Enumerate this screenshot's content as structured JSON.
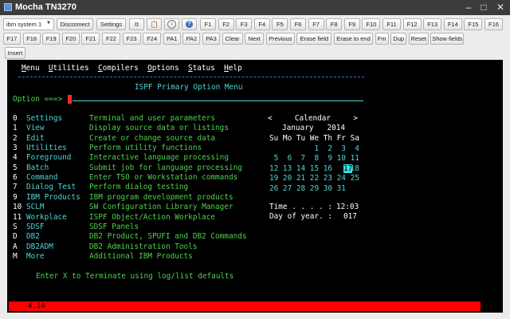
{
  "window": {
    "title": "Mocha TN3270",
    "minimize": "–",
    "maximize": "□",
    "close": "✕"
  },
  "toolbar": {
    "session_select": "ibm system 1",
    "disconnect": "Disconnect",
    "settings": "Settings",
    "icons": [
      "copy-icon",
      "paste-icon",
      "info-icon",
      "help-icon"
    ],
    "help_glyph": "?",
    "info_glyph": "i",
    "fkeys_row1": [
      "F1",
      "F2",
      "F3",
      "F4",
      "F5",
      "F6",
      "F7",
      "F8",
      "F9",
      "F10",
      "F11",
      "F12",
      "F13",
      "F14",
      "F15",
      "F16"
    ],
    "fkeys_row2": [
      "F17",
      "F18",
      "F19",
      "F20",
      "F21",
      "F22",
      "F23",
      "F24",
      "PA1",
      "PA2",
      "PA3",
      "Clear",
      "Next",
      "Previous",
      "Erase field",
      "Erase to end",
      "Fm",
      "Dup",
      "Reset",
      "Show fields"
    ],
    "insert": "Insert"
  },
  "terminal": {
    "menu": [
      "Menu",
      "Utilities",
      "Compilers",
      "Options",
      "Status",
      "Help"
    ],
    "panel_title": "ISPF Primary Option Menu",
    "option_prompt": "Option ===>",
    "options": [
      {
        "key": "0",
        "name": "Settings",
        "desc": "Terminal and user parameters"
      },
      {
        "key": "1",
        "name": "View",
        "desc": "Display source data or listings"
      },
      {
        "key": "2",
        "name": "Edit",
        "desc": "Create or change source data"
      },
      {
        "key": "3",
        "name": "Utilities",
        "desc": "Perform utility functions"
      },
      {
        "key": "4",
        "name": "Foreground",
        "desc": "Interactive language processing"
      },
      {
        "key": "5",
        "name": "Batch",
        "desc": "Submit job for language processing"
      },
      {
        "key": "6",
        "name": "Command",
        "desc": "Enter TSO or Workstation commands"
      },
      {
        "key": "7",
        "name": "Dialog Test",
        "desc": "Perform dialog testing"
      },
      {
        "key": "9",
        "name": "IBM Products",
        "desc": "IBM program development products"
      },
      {
        "key": "10",
        "name": "SCLM",
        "desc": "SW Configuration Library Manager"
      },
      {
        "key": "11",
        "name": "Workplace",
        "desc": "ISPF Object/Action Workplace"
      },
      {
        "key": "S",
        "name": "SDSF",
        "desc": "SDSF Panels"
      },
      {
        "key": "D",
        "name": "DB2",
        "desc": "DB2 Product, SPUFI and DB2 Commands"
      },
      {
        "key": "A",
        "name": "DB2ADM",
        "desc": "DB2 Administration Tools"
      },
      {
        "key": "M",
        "name": "More",
        "desc": "Additional IBM Products"
      }
    ],
    "calendar": {
      "prev": "<",
      "title": "Calendar",
      "next": ">",
      "month_year": "January   2014",
      "weekdays": "Su Mo Tu We Th Fr Sa",
      "weeks": [
        "          1  2  3  4",
        " 5  6  7  8  9 10 11",
        "12 13 14 15 16    18",
        "19 20 21 22 23 24 25",
        "26 27 28 29 30 31"
      ],
      "today": "17"
    },
    "time_label": "Time . . . . :",
    "time_value": "12:03",
    "day_label": "Day of year. :",
    "day_value": "017",
    "footer_hint": "Enter X to Terminate using log/list defaults",
    "cursor_position": "4,14"
  },
  "colors": {
    "title_bar": "#3c3c3c",
    "screen_bg": "#000000",
    "status_bar": "#ff0000",
    "green": "#4fd14f",
    "cyan": "#4fd5d5",
    "blue": "#7fa8ff"
  }
}
